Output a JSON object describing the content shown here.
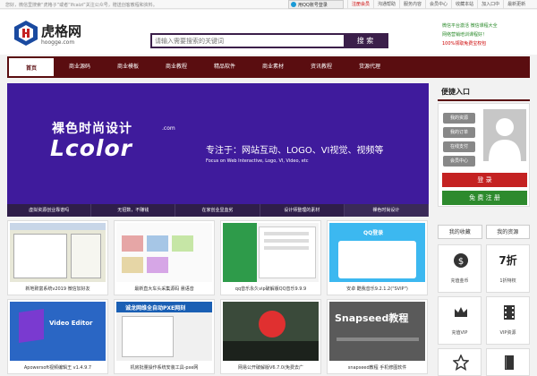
{
  "topbar": {
    "welcome": "您好，微信里搜索“虎格子”或者“lfcaizi”关注公众号，赠送创客教程和资料。",
    "qq_login": "用QQ账号登录",
    "links": [
      "注册会员",
      "沟通帮助",
      "服务内容",
      "会员中心",
      "收藏本站",
      "加入口中",
      "最新更新"
    ]
  },
  "header": {
    "logo_name": "虎格网",
    "logo_domain": "hoogge.com",
    "search_placeholder": "请输入需要搜索的关键词",
    "search_button": "搜 索",
    "promo": [
      "微信平台激活 微信课程大全",
      "网络营销培训课程好！",
      "100%领取免费宝权包"
    ]
  },
  "nav": [
    "首页",
    "商业源码",
    "商业模板",
    "商业教程",
    "精品软件",
    "商业素材",
    "资讯教程",
    "货源代理"
  ],
  "banner": {
    "cn_brand": "裸色时尚设计",
    "dotcom": ".com",
    "logo_word": "Lcolor",
    "slogan": "专注于：网站互动、LOGO、VI视觉、视频等",
    "sub": "Focus on Web Interactive, Logo, VI, Video, etc",
    "tabs": [
      "虚拟资源创业靠谱吗",
      "无招数，不赚钱",
      "在家创业显血劣",
      "设计师整理的素材",
      "裸色时尚设计"
    ]
  },
  "cards": [
    {
      "caption": "新地致富系统v2019 微信加好友",
      "thumb_title": ""
    },
    {
      "caption": "最新直大车头采集源码 悬语音",
      "thumb_title": ""
    },
    {
      "caption": "qq音乐永久vip破解版QQ音乐9.9.9",
      "thumb_title": ""
    },
    {
      "caption": "安卓 酷我音乐9.2.1.2(\"SVIP\")",
      "thumb_title": "QQ登录"
    },
    {
      "caption": "Apowersoft视频编辑王 v1.4.9.7",
      "thumb_title": "Video Editor"
    },
    {
      "caption": "机房批量操作系统安装工具-pxe网",
      "thumb_title": "诚龙网维全自动PXE网刻"
    },
    {
      "caption": "网易公开破解版V6.7.0(免费去广",
      "thumb_title": ""
    },
    {
      "caption": "snapseed教程 手机修图软件",
      "thumb_title": "Snapseed教程"
    }
  ],
  "sidebar": {
    "title": "便捷入口",
    "quick": [
      "我的资源",
      "我的订单",
      "在线支付",
      "会员中心"
    ],
    "login": "登 录",
    "register": "免 费 注 册",
    "tabs": [
      "我的收藏",
      "我的资源"
    ],
    "features": [
      {
        "label": "充值金币",
        "value": ""
      },
      {
        "label": "1折特权",
        "value": "7折"
      },
      {
        "label": "充值VIP",
        "value": ""
      },
      {
        "label": "VIP资源",
        "value": ""
      }
    ]
  },
  "colors": {
    "nav_bg": "#5a0d10",
    "banner_bg": "#3f1b9c",
    "login": "#c42222",
    "register": "#2d8a2d",
    "search": "#3b1f4a"
  }
}
